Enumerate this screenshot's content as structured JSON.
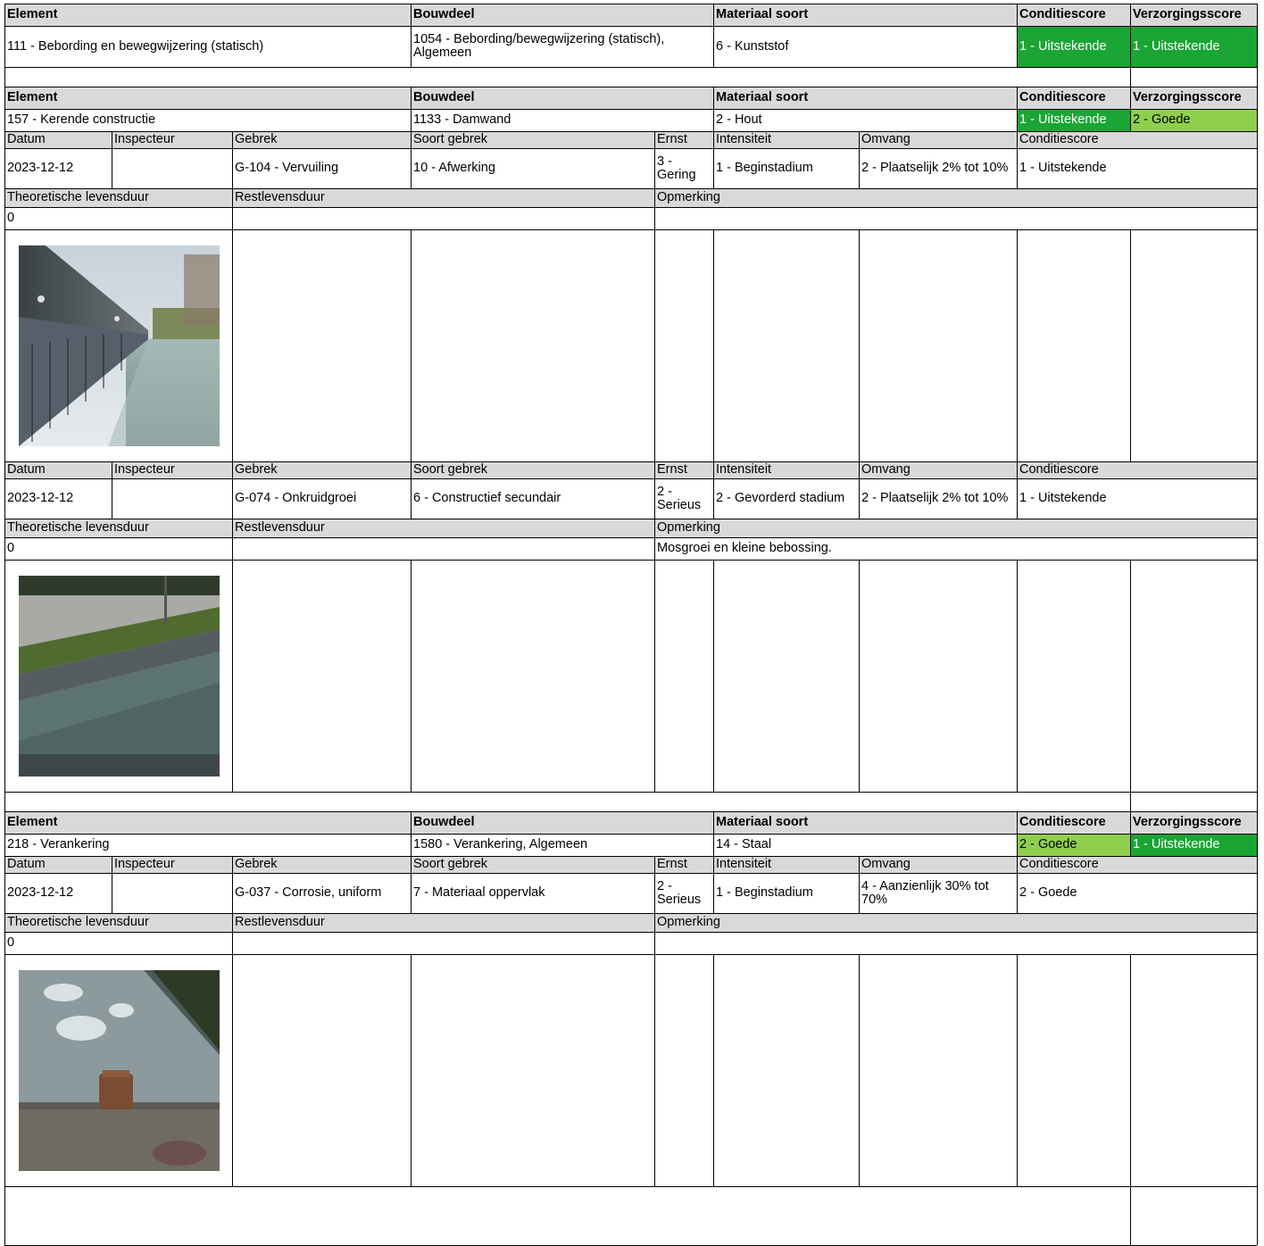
{
  "headers": {
    "element": "Element",
    "bouwdeel": "Bouwdeel",
    "materiaal": "Materiaal soort",
    "conditiescore": "Conditiescore",
    "verzorgingsscore": "Verzorgingsscore"
  },
  "sub_headers": {
    "datum": "Datum",
    "inspecteur": "Inspecteur",
    "gebrek": "Gebrek",
    "soort_gebrek": "Soort gebrek",
    "ernst": "Ernst",
    "intensiteit": "Intensiteit",
    "omvang": "Omvang",
    "conditiescore": "Conditiescore",
    "theoretische_levensduur": "Theoretische levensduur",
    "restlevensduur": "Restlevensduur",
    "opmerking": "Opmerking"
  },
  "score_colors": {
    "excellent": "#1aa534",
    "good": "#8fcf4e"
  },
  "elements": [
    {
      "element": "111 - Bebording en bewegwijzering (statisch)",
      "bouwdeel": "1054 - Bebording/bewegwijzering (statisch), Algemeen",
      "materiaal": "6 - Kunststof",
      "conditiescore": "1 - Uitstekende",
      "verzorgingsscore": "1 - Uitstekende"
    },
    {
      "element": "157 - Kerende constructie",
      "bouwdeel": "1133 - Damwand",
      "materiaal": "2 - Hout",
      "conditiescore": "1 - Uitstekende",
      "verzorgingsscore": "2 - Goede",
      "defects": [
        {
          "datum": "2023-12-12",
          "inspecteur": "",
          "gebrek": "G-104 - Vervuiling",
          "soort_gebrek": "10 - Afwerking",
          "ernst": "3 - Gering",
          "intensiteit": "1 - Beginstadium",
          "omvang": "2 - Plaatselijk 2% tot 10%",
          "conditiescore": "1 - Uitstekende",
          "theoretische_levensduur": "0",
          "restlevensduur": "",
          "opmerking": "",
          "photo_icon": "wooden-sheet-pile-canal-photo"
        },
        {
          "datum": "2023-12-12",
          "inspecteur": "",
          "gebrek": "G-074 - Onkruidgroei",
          "soort_gebrek": "6 - Constructief secundair",
          "ernst": "2 - Serieus",
          "intensiteit": "2 - Gevorderd stadium",
          "omvang": "2 - Plaatselijk 2% tot 10%",
          "conditiescore": "1 - Uitstekende",
          "theoretische_levensduur": "0",
          "restlevensduur": "",
          "opmerking": "Mosgroei en kleine bebossing.",
          "photo_icon": "overgrown-canal-wall-photo"
        }
      ]
    },
    {
      "element": "218 - Verankering",
      "bouwdeel": "1580 - Verankering, Algemeen",
      "materiaal": "14 - Staal",
      "conditiescore": "2 - Goede",
      "verzorgingsscore": "1 - Uitstekende",
      "defects": [
        {
          "datum": "2023-12-12",
          "inspecteur": "",
          "gebrek": "G-037 - Corrosie, uniform",
          "soort_gebrek": "7 - Materiaal oppervlak",
          "ernst": "2 - Serieus",
          "intensiteit": "1 - Beginstadium",
          "omvang": "4 - Aanzienlijk 30% tot 70%",
          "conditiescore": "2 - Goede",
          "theoretische_levensduur": "0",
          "restlevensduur": "",
          "opmerking": "",
          "photo_icon": "rusted-anchor-bolt-photo"
        }
      ]
    }
  ]
}
